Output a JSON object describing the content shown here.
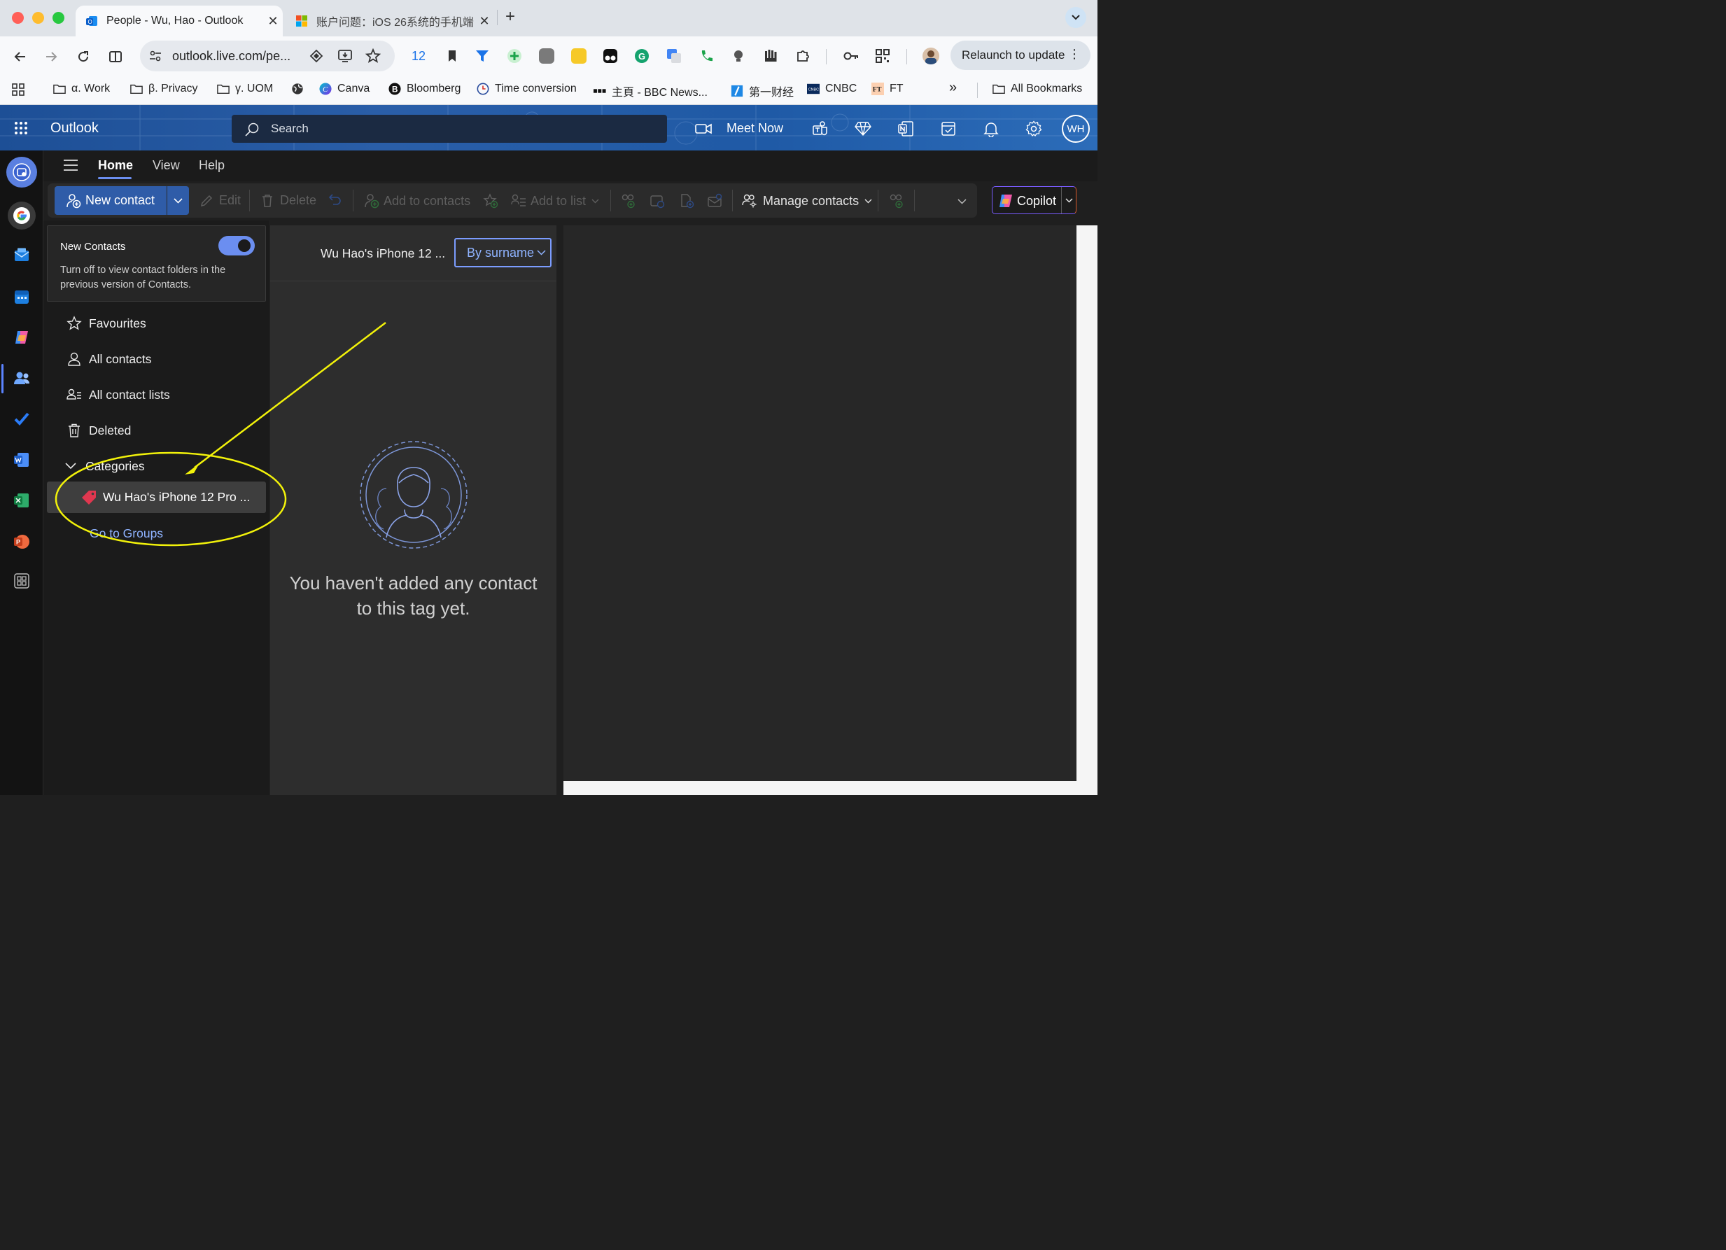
{
  "browser": {
    "tabs": [
      {
        "title": "People - Wu, Hao - Outlook",
        "active": true
      },
      {
        "title": "账户问题：iOS 26系统的手机端",
        "active": false
      }
    ],
    "new_tab": "+",
    "url": "outlook.live.com/pe...",
    "extension_badge": "12",
    "relaunch": "Relaunch to update",
    "bookmarks": [
      {
        "label": "α. Work",
        "icon": "folder-icon"
      },
      {
        "label": "β. Privacy",
        "icon": "folder-icon"
      },
      {
        "label": "γ. UOM",
        "icon": "folder-icon"
      },
      {
        "label": "",
        "icon": "globe-icon"
      },
      {
        "label": "Canva",
        "icon": "canva-icon"
      },
      {
        "label": "Bloomberg",
        "icon": "bloomberg-icon"
      },
      {
        "label": "Time conversion",
        "icon": "clock-icon"
      },
      {
        "label": "主頁 - BBC News...",
        "icon": "bbc-icon"
      },
      {
        "label": "第一财经",
        "icon": "yicai-icon"
      },
      {
        "label": "CNBC",
        "icon": "cnbc-icon"
      },
      {
        "label": "FT",
        "icon": "ft-icon"
      }
    ],
    "bookmarks_overflow": "»",
    "all_bookmarks": "All Bookmarks"
  },
  "outlook": {
    "app_name": "Outlook",
    "search_placeholder": "Search",
    "meet_now": "Meet Now",
    "avatar_initials": "WH",
    "ribbon_tabs": [
      "Home",
      "View",
      "Help"
    ],
    "ribbon": {
      "new_contact": "New contact",
      "edit": "Edit",
      "delete": "Delete",
      "add_to_contacts": "Add to contacts",
      "add_to_list": "Add to list",
      "manage_contacts": "Manage contacts",
      "copilot": "Copilot"
    },
    "folder_pane": {
      "new_contacts_title": "New Contacts",
      "new_contacts_desc": "Turn off to view contact folders in the previous version of Contacts.",
      "toggle_on": true,
      "items": [
        "Favourites",
        "All contacts",
        "All contact lists",
        "Deleted"
      ],
      "categories_label": "Categories",
      "category": "Wu Hao's iPhone 12 Pro ...",
      "go_to_groups": "Go to Groups"
    },
    "list_pane": {
      "title": "Wu Hao's iPhone 12 ...",
      "sort": "By surname",
      "empty_line1": "You haven't added any contact",
      "empty_line2": "to this tag yet."
    }
  },
  "colors": {
    "accent": "#2f5ca8",
    "link": "#8fb3ff",
    "annotation": "#f2f20a",
    "tag": "#e0374f"
  }
}
